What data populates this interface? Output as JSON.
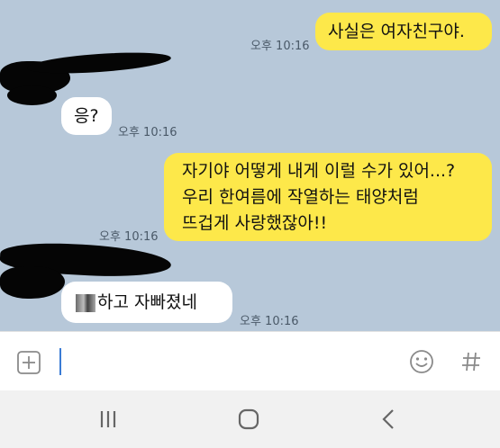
{
  "messages": [
    {
      "side": "me",
      "text": "사실은 여자친구야.",
      "time": "오후 10:16"
    },
    {
      "side": "them",
      "text": "응?",
      "time": "오후 10:16"
    },
    {
      "side": "me",
      "lines": [
        "자기야 어떻게 내게 이럴 수가 있어...?",
        "우리 한여름에 작열하는 태양처럼",
        "뜨겁게 사랑했잖아!!"
      ],
      "time": "오후 10:16"
    },
    {
      "side": "them",
      "text": "하고 자빠졌네",
      "time": "오후 10:16"
    }
  ],
  "input": {
    "value": "",
    "left_icon": "plus-square-icon",
    "right_icons": [
      "emoji-icon",
      "hash-icon"
    ]
  },
  "nav": {
    "icons": [
      "recent-apps-icon",
      "home-icon",
      "back-icon"
    ]
  },
  "colors": {
    "chat_bg": "#b7c8d9",
    "my_bubble": "#fde84a",
    "their_bubble": "#ffffff"
  }
}
